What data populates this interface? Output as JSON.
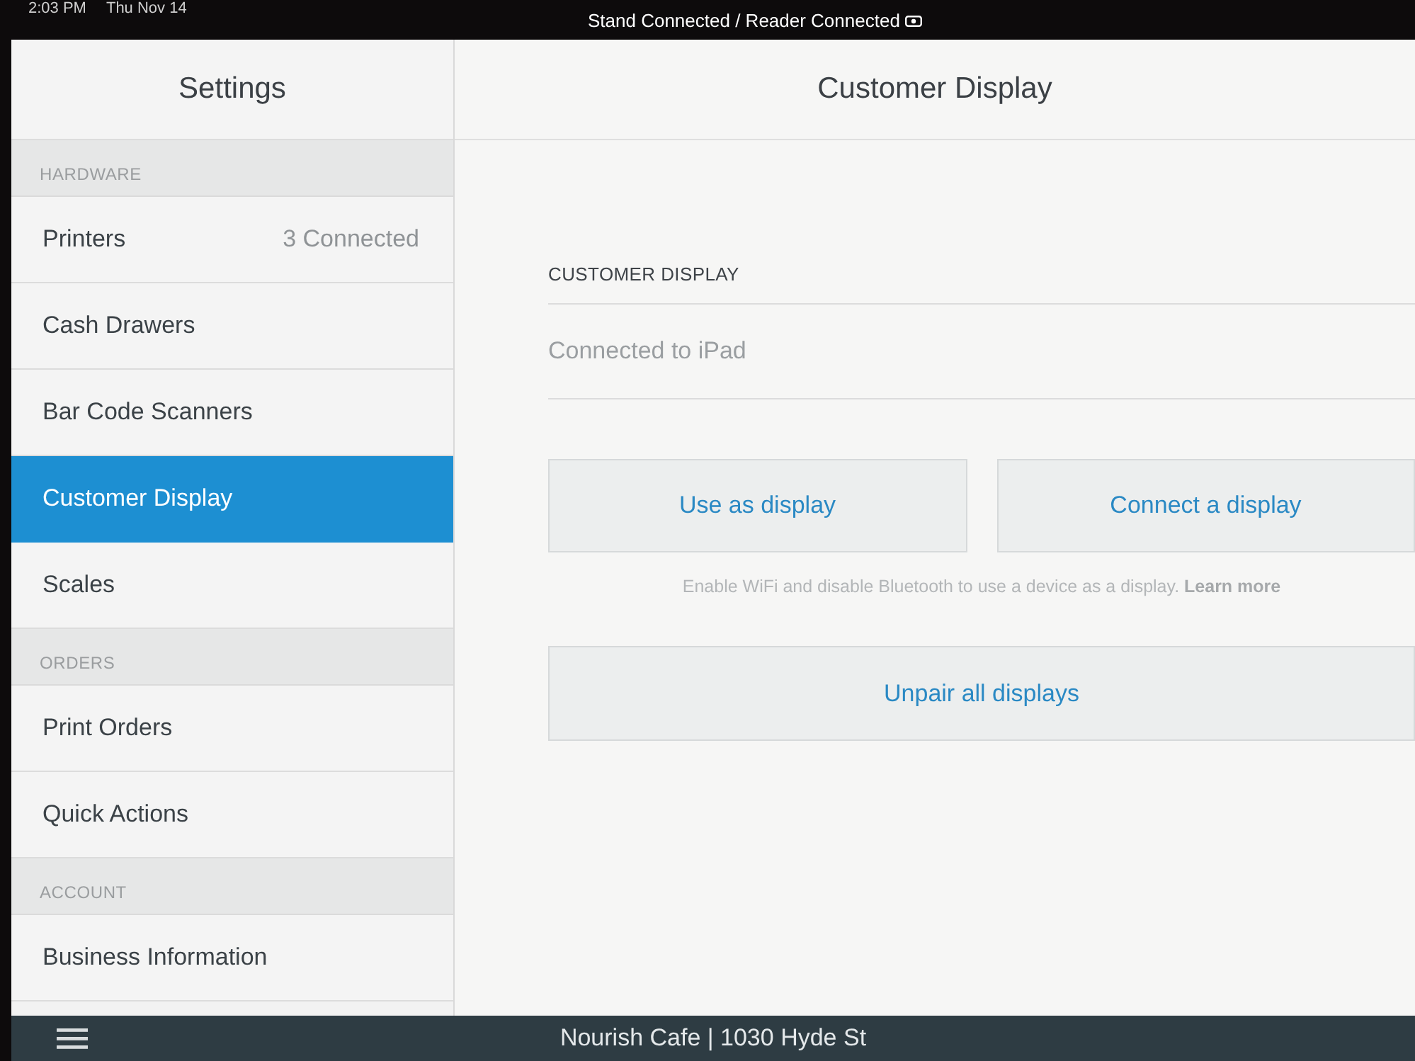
{
  "status_bar": {
    "time": "2:03 PM",
    "date": "Thu Nov 14",
    "connection": "Stand Connected / Reader Connected"
  },
  "sidebar": {
    "title": "Settings",
    "sections": [
      {
        "label": "HARDWARE",
        "items": [
          {
            "label": "Printers",
            "detail": "3 Connected",
            "selected": false
          },
          {
            "label": "Cash Drawers",
            "selected": false
          },
          {
            "label": "Bar Code Scanners",
            "selected": false
          },
          {
            "label": "Customer Display",
            "selected": true
          },
          {
            "label": "Scales",
            "selected": false
          }
        ]
      },
      {
        "label": "ORDERS",
        "items": [
          {
            "label": "Print Orders",
            "selected": false
          },
          {
            "label": "Quick Actions",
            "selected": false
          }
        ]
      },
      {
        "label": "ACCOUNT",
        "items": [
          {
            "label": "Business Information",
            "selected": false
          }
        ]
      }
    ]
  },
  "detail": {
    "title": "Customer Display",
    "section_label": "CUSTOMER DISPLAY",
    "status_row": "Connected to iPad",
    "buttons": [
      "Use as display",
      "Connect a display"
    ],
    "hint": {
      "text": "Enable WiFi and disable Bluetooth to use a device as a display.",
      "link": "Learn more"
    },
    "unpair_button": "Unpair all displays"
  },
  "bottom_bar": {
    "location": "Nourish Cafe | 1030 Hyde St"
  }
}
